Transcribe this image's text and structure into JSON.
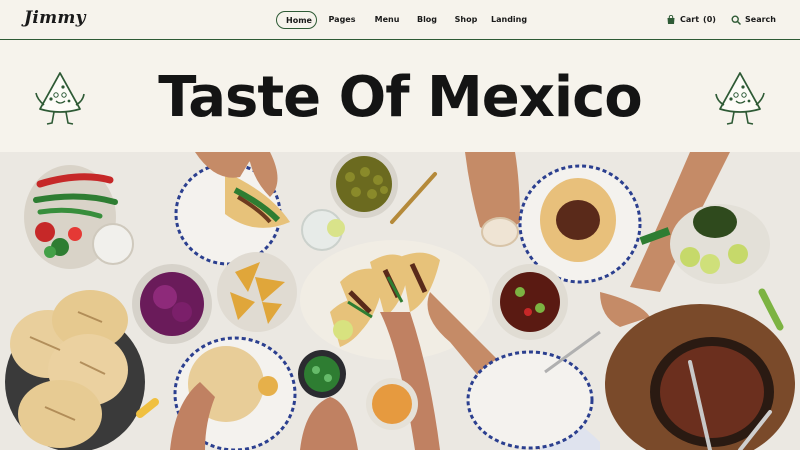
{
  "brand": {
    "logo_text": "Jimmy"
  },
  "nav": {
    "items": [
      {
        "label": "Home",
        "active": true
      },
      {
        "label": "Pages",
        "active": false
      },
      {
        "label": "Menu",
        "active": false
      },
      {
        "label": "Blog",
        "active": false
      },
      {
        "label": "Shop",
        "active": false
      },
      {
        "label": "Landing",
        "active": false
      }
    ]
  },
  "tools": {
    "cart_label": "Cart",
    "cart_count": "(0)",
    "search_label": "Search",
    "cart_icon": "shopping-bag-icon",
    "search_icon": "search-icon"
  },
  "hero": {
    "title": "Taste Of Mexico",
    "mascot_icon": "nacho-chip-mascot-icon",
    "photo_description_icon": "food-table-photo"
  },
  "colors": {
    "background": "#f6f3ec",
    "accent_green": "#2e5a35",
    "text": "#1a1a1a"
  }
}
